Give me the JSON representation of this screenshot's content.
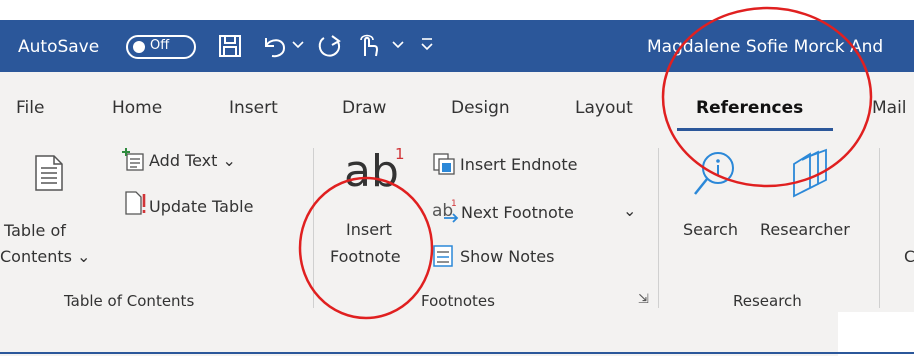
{
  "titlebar": {
    "autosave_label": "AutoSave",
    "autosave_state": "Off",
    "doc_title": "Magdalene Sofie Morck And",
    "bg_color": "#2B579A"
  },
  "tabs": [
    {
      "label": "File"
    },
    {
      "label": "Home"
    },
    {
      "label": "Insert"
    },
    {
      "label": "Draw"
    },
    {
      "label": "Design"
    },
    {
      "label": "Layout"
    },
    {
      "label": "References",
      "active": true
    },
    {
      "label": "Mail"
    }
  ],
  "ribbon": {
    "toc": {
      "table_of_label": "Table of",
      "contents_label": "Contents ⌄",
      "add_text_label": "Add Text ⌄",
      "update_table_label": "Update Table",
      "group_label": "Table of Contents"
    },
    "footnotes": {
      "ab_glyph": "ab",
      "sup_glyph": "1",
      "insert_label": "Insert",
      "footnote_label": "Footnote",
      "insert_endnote_label": "Insert Endnote",
      "next_footnote_label": "Next Footnote",
      "show_notes_label": "Show Notes",
      "group_label": "Footnotes",
      "dropdown_glyph": "⌄",
      "launcher_glyph": "⇲"
    },
    "research": {
      "search_label": "Search",
      "researcher_label": "Researcher",
      "group_label": "Research"
    },
    "cut_letter": "C"
  },
  "annotations": {
    "circle_color": "#E02020"
  }
}
